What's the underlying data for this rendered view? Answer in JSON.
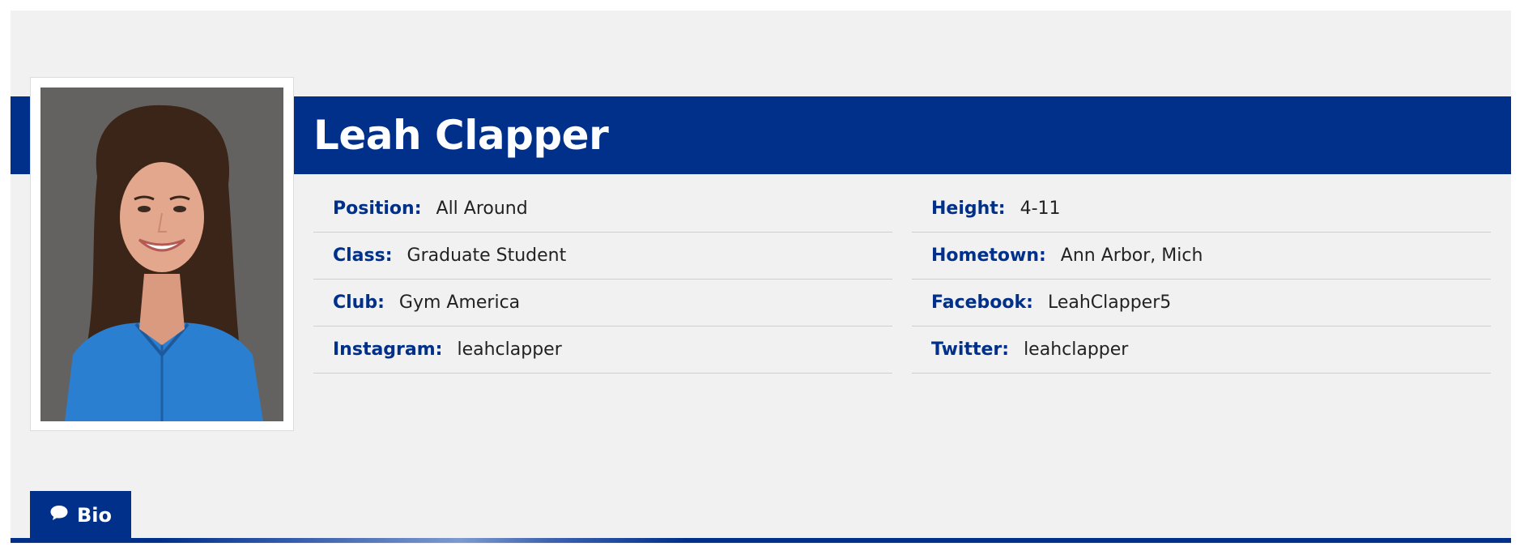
{
  "player": {
    "name": "Leah Clapper"
  },
  "details": {
    "left": [
      {
        "label": "Position:",
        "value": "All Around"
      },
      {
        "label": "Class:",
        "value": "Graduate Student"
      },
      {
        "label": "Club:",
        "value": "Gym America"
      },
      {
        "label": "Instagram:",
        "value": "leahclapper"
      }
    ],
    "right": [
      {
        "label": "Height:",
        "value": "4-11"
      },
      {
        "label": "Hometown:",
        "value": "Ann Arbor, Mich"
      },
      {
        "label": "Facebook:",
        "value": "LeahClapper5"
      },
      {
        "label": "Twitter:",
        "value": "leahclapper"
      }
    ]
  },
  "tabs": {
    "bio": {
      "label": "Bio",
      "icon": "comment-icon"
    }
  },
  "colors": {
    "brand_blue": "#00308a",
    "panel_bg": "#f1f1f1",
    "label_text": "#00308a",
    "value_text": "#222222"
  }
}
